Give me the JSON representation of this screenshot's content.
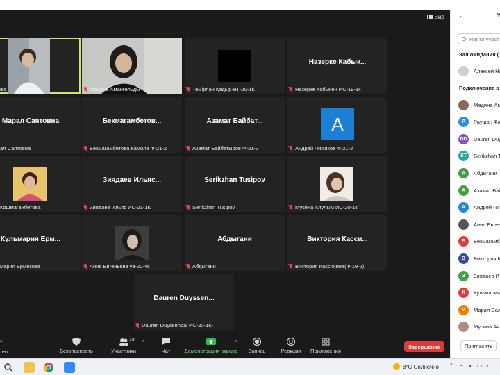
{
  "view_label": "Вид",
  "tiles": [
    {
      "name": "Фатылова",
      "big": ""
    },
    {
      "name": "Мадина Амангельды",
      "big": ""
    },
    {
      "name": "Темірлан Қадыр-ВТ-20-1К",
      "big": ""
    },
    {
      "name": "Назерке Кабыкен ИС-19-1к",
      "big": "Назерке Кабык..."
    },
    {
      "name": "ал Саятовна",
      "big": "Марал Саятовна"
    },
    {
      "name": "Бекмагамбетова Камила Ф-21-2",
      "big": "Бекмагамбетов..."
    },
    {
      "name": "Азамат Байбатыров Ф-21-2",
      "big": "Азамат Байбат..."
    },
    {
      "name": "Андрей Чижиков Ф-21-2",
      "big": "",
      "avatar_letter": "A"
    },
    {
      "name": "Кошмаганбетова",
      "big": ""
    },
    {
      "name": "Зиядаев Ильяс ИС-21-1К",
      "big": "Зиядаев Ильяс..."
    },
    {
      "name": "Serikzhan Tusipov",
      "big": "Serikzhan Tusipov"
    },
    {
      "name": "Мусина Аяулым ИС-20-1к",
      "big": ""
    },
    {
      "name": "мария Ермекова",
      "big": "Кульмария Ерм..."
    },
    {
      "name": "Анна Евгеньева уа-20-4с",
      "big": ""
    },
    {
      "name": "Абдыгани",
      "big": "Абдыгани"
    },
    {
      "name": "Виктория Кассихина(Ф-19-2)",
      "big": "Виктория Касси..."
    },
    {
      "name": "Dauren Duyssenbai ИС-20-1К-",
      "big": "Dauren Duyssen..."
    }
  ],
  "toolbar": {
    "video_label": "ео",
    "security_label": "Безопасность",
    "participants_label": "Участники",
    "participants_count": "18",
    "chat_label": "Чат",
    "share_label": "Демонстрация экрана",
    "record_label": "Запись",
    "reactions_label": "Реакции",
    "apps_label": "Приложения",
    "end_label": "Завершение"
  },
  "panel": {
    "title_letter": "У",
    "search_placeholder": "Найти участ",
    "waiting_label": "Зал ожидания (",
    "waiting": [
      {
        "name": "Алексей На",
        "initial": "",
        "color": "#cfcfcf"
      }
    ],
    "connected_label": "Подключение в",
    "participants": [
      {
        "name": "Мадина Ам",
        "initial": "",
        "color": "#8a6a55"
      },
      {
        "name": "Раушан Фа",
        "initial": "P",
        "color": "#2d8cf0"
      },
      {
        "name": "Dauren Duy",
        "initial": "DD",
        "color": "#7e57c2"
      },
      {
        "name": "Serikzhan T",
        "initial": "ST",
        "color": "#26a69a"
      },
      {
        "name": "Абдыгани",
        "initial": "A",
        "color": "#43a047"
      },
      {
        "name": "Азамат Бай",
        "initial": "A",
        "color": "#43a047"
      },
      {
        "name": "Андрей Чиж",
        "initial": "A",
        "color": "#1e88e5"
      },
      {
        "name": "Анна Евген",
        "initial": "",
        "color": "#555555"
      },
      {
        "name": "Бекмагамб",
        "initial": "Б",
        "color": "#e53935"
      },
      {
        "name": "Виктория К",
        "initial": "В",
        "color": "#3949ab"
      },
      {
        "name": "Зиядаев И",
        "initial": "З",
        "color": "#43a047"
      },
      {
        "name": "Кульмария",
        "initial": "К",
        "color": "#e53935"
      },
      {
        "name": "Марал Сая",
        "initial": "М",
        "color": "#f57c00"
      },
      {
        "name": "Мусина Ая",
        "initial": "",
        "color": "#b08c7a"
      }
    ],
    "invite_label": "Пригласить"
  },
  "taskbar": {
    "weather_text": "8°C  Солнечно"
  }
}
